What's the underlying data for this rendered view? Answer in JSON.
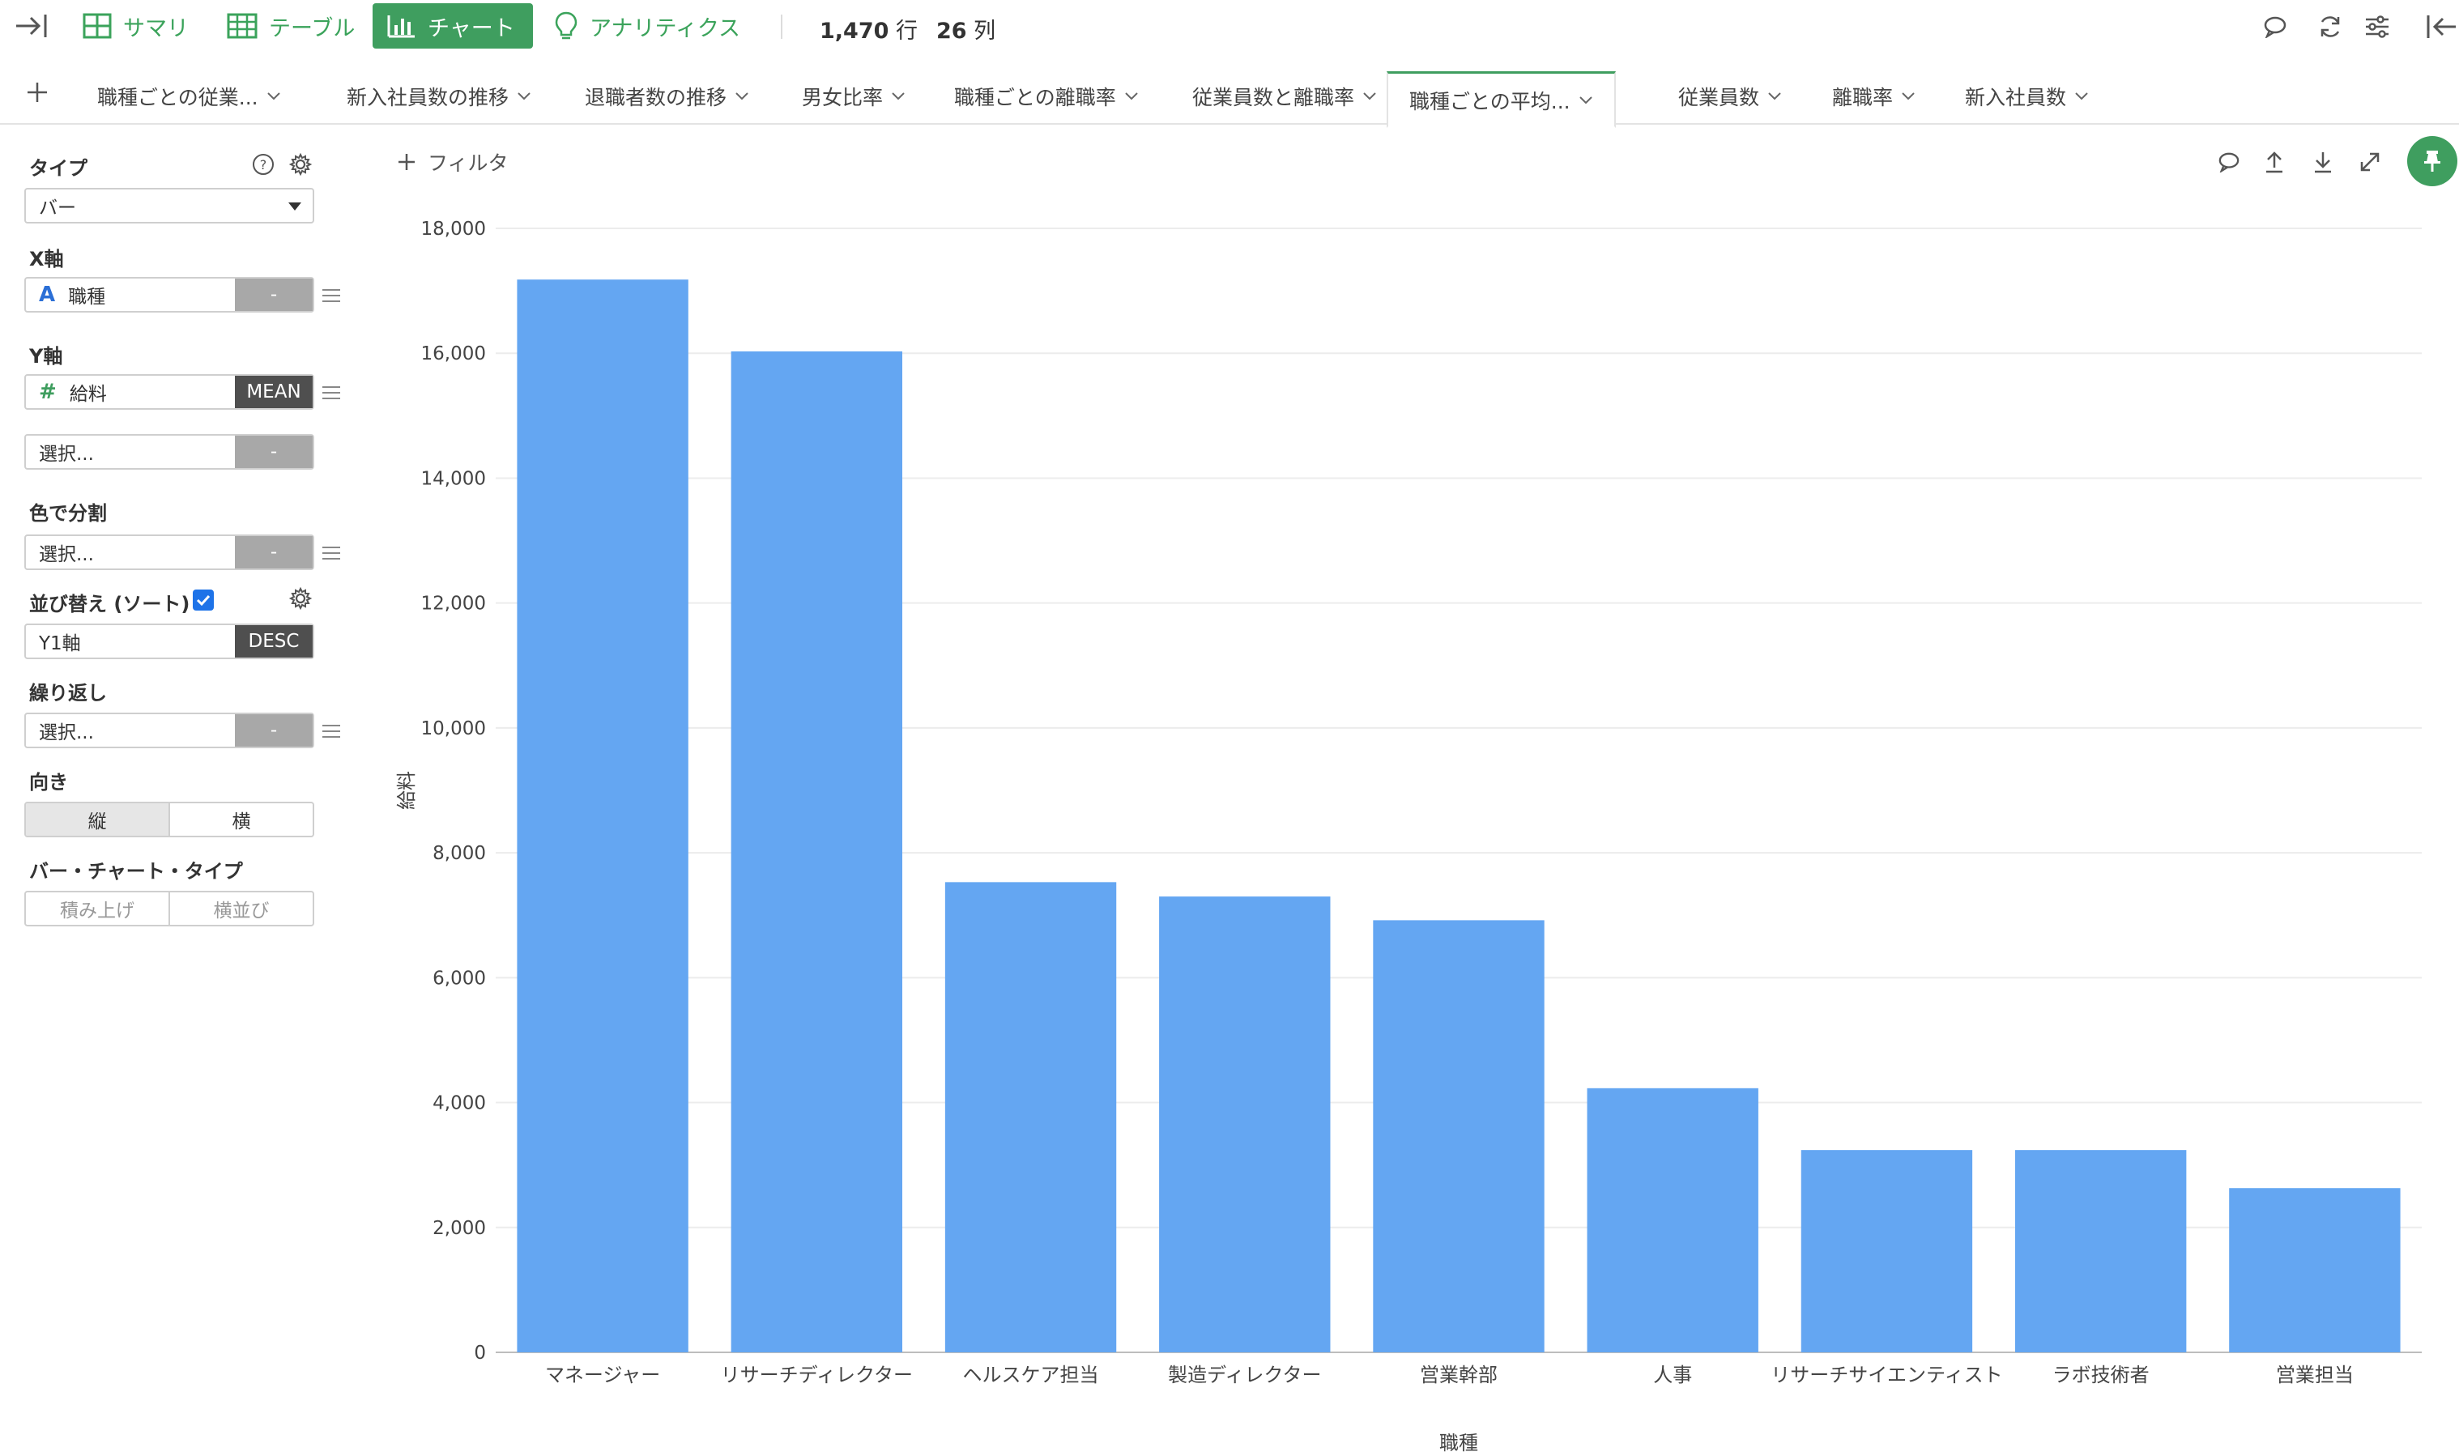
{
  "toolbar": {
    "summary": "サマリ",
    "table": "テーブル",
    "chart": "チャート",
    "analytics": "アナリティクス",
    "rows_count": "1,470",
    "rows_unit": "行",
    "cols_count": "26",
    "cols_unit": "列"
  },
  "tabs": [
    {
      "label": "職種ごとの従業..."
    },
    {
      "label": "新入社員数の推移"
    },
    {
      "label": "退職者数の推移"
    },
    {
      "label": "男女比率"
    },
    {
      "label": "職種ごとの離職率"
    },
    {
      "label": "従業員数と離職率"
    },
    {
      "label": "職種ごとの平均..."
    },
    {
      "label": "従業員数"
    },
    {
      "label": "離職率"
    },
    {
      "label": "新入社員数"
    }
  ],
  "panel": {
    "type_label": "タイプ",
    "type_value": "バー",
    "x_label": "X軸",
    "x_field": "職種",
    "x_agg": "-",
    "y_label": "Y軸",
    "y_field": "給料",
    "y_agg": "MEAN",
    "y2_placeholder": "選択...",
    "y2_agg": "-",
    "color_label": "色で分割",
    "color_placeholder": "選択...",
    "color_agg": "-",
    "sort_label": "並び替え (ソート)",
    "sort_field": "Y1軸",
    "sort_order": "DESC",
    "repeat_label": "繰り返し",
    "repeat_placeholder": "選択...",
    "repeat_agg": "-",
    "orientation_label": "向き",
    "orientation_vertical": "縦",
    "orientation_horizontal": "横",
    "bar_type_label": "バー・チャート・タイプ",
    "bar_type_stacked": "積み上げ",
    "bar_type_side": "横並び"
  },
  "filter": {
    "label": "フィルタ"
  },
  "colors": {
    "accent": "#3f9e5f",
    "bar": "#64a6f2",
    "checkbox": "#1e73e8"
  },
  "chart_data": {
    "type": "bar",
    "categories": [
      "マネージャー",
      "リサーチディレクター",
      "ヘルスケア担当",
      "製造ディレクター",
      "営業幹部",
      "人事",
      "リサーチサイエンティスト",
      "ラボ技術者",
      "営業担当"
    ],
    "values": [
      17180,
      16030,
      7530,
      7300,
      6920,
      4230,
      3240,
      3240,
      2630
    ],
    "xlabel": "職種",
    "ylabel": "給料",
    "ylim": [
      0,
      18000
    ],
    "yticks": [
      0,
      2000,
      4000,
      6000,
      8000,
      10000,
      12000,
      14000,
      16000,
      18000
    ],
    "grid": true,
    "legend": "none"
  }
}
